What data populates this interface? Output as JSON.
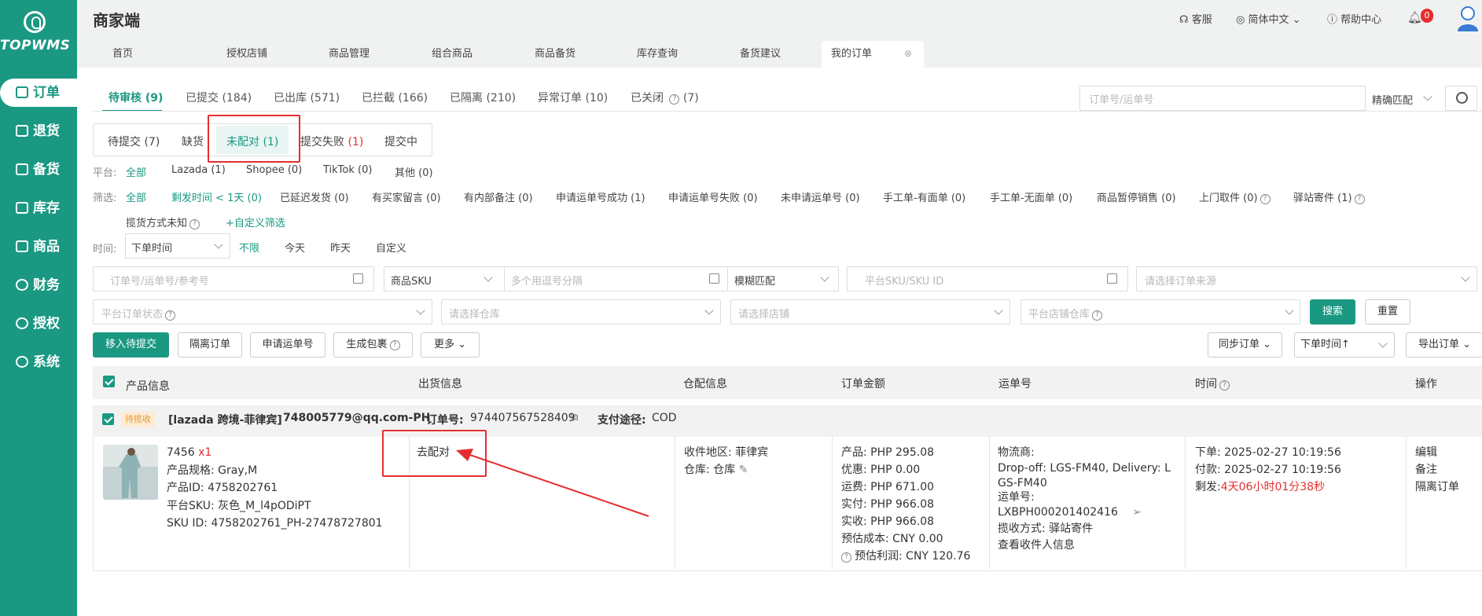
{
  "app": {
    "title": "商家端",
    "logo": "TOPWMS"
  },
  "header": {
    "service": "客服",
    "language": "简体中文",
    "help_center": "帮助中心",
    "notification_count": "0"
  },
  "sidebar": {
    "items": [
      {
        "label": "订单",
        "icon": "order-icon"
      },
      {
        "label": "退货",
        "icon": "return-icon"
      },
      {
        "label": "备货",
        "icon": "stock-icon"
      },
      {
        "label": "库存",
        "icon": "inventory-icon"
      },
      {
        "label": "商品",
        "icon": "goods-icon"
      },
      {
        "label": "财务",
        "icon": "finance-icon"
      },
      {
        "label": "授权",
        "icon": "auth-icon"
      },
      {
        "label": "系统",
        "icon": "system-icon"
      }
    ]
  },
  "page_tabs": [
    "首页",
    "授权店铺",
    "商品管理",
    "组合商品",
    "商品备货",
    "库存查询",
    "备货建议",
    "我的订单"
  ],
  "status_tabs": [
    "待审核 (9)",
    "已提交 (184)",
    "已出库 (571)",
    "已拦截 (166)",
    "已隔离 (210)",
    "异常订单 (10)",
    "已关闭",
    "(7)"
  ],
  "search": {
    "placeholder": "订单号/运单号",
    "match": "精确匹配"
  },
  "sub_tabs": {
    "pending": "待提交 (7)",
    "shortage": "缺货",
    "unmatched": "未配对 (1)",
    "failed_label": "提交失败",
    "failed_count": "(1)",
    "submitting": "提交中"
  },
  "platform_filter": {
    "label": "平台:",
    "options": [
      "全部",
      "Lazada (1)",
      "Shopee (0)",
      "TikTok (0)",
      "其他 (0)"
    ]
  },
  "screen_filter": {
    "label": "筛选:",
    "options": [
      "全部",
      "剩发时间 < 1天 (0)",
      "已延迟发货 (0)",
      "有买家留言 (0)",
      "有内部备注 (0)",
      "申请运单号成功 (1)",
      "申请运单号失败 (0)",
      "未申请运单号 (0)",
      "手工单-有面单 (0)",
      "手工单-无面单 (0)",
      "商品暂停销售 (0)",
      "上门取件 (0)",
      "驿站寄件 (1)"
    ],
    "row2": [
      "揽货方式未知",
      "+自定义筛选"
    ]
  },
  "time_filter": {
    "label": "时间:",
    "select": "下单时间",
    "options": [
      "不限",
      "今天",
      "昨天",
      "自定义"
    ]
  },
  "search_fields": {
    "order_no": "订单号/运单号/参考号",
    "sku_type": "商品SKU",
    "multi": "多个用逗号分隔",
    "fuzzy": "模糊匹配",
    "platform_sku": "平台SKU/SKU ID",
    "source": "请选择订单来源",
    "platform_status": "平台订单状态",
    "warehouse": "请选择仓库",
    "store": "请选择店铺",
    "store_warehouse": "平台店铺仓库",
    "search_btn": "搜索",
    "reset_btn": "重置"
  },
  "actions": {
    "move": "移入待提交",
    "isolate": "隔离订单",
    "apply": "申请运单号",
    "package": "生成包裹",
    "more": "更多",
    "sync": "同步订单",
    "sort": "下单时间↑",
    "export": "导出订单"
  },
  "table": {
    "headers": [
      "产品信息",
      "出货信息",
      "仓配信息",
      "订单金额",
      "运单号",
      "时间",
      "操作"
    ],
    "order": {
      "badge": "待揽收",
      "store": "[lazada 跨境-菲律宾]",
      "email": "748005779@qq.com-PH",
      "order_label": "订单号:",
      "order_no": "974407567528409",
      "pay_label": "支付途径:",
      "pay": "COD",
      "product": {
        "name": "7456",
        "qty": "x1",
        "spec": "产品规格: Gray,M",
        "pid": "产品ID: 4758202761",
        "psku": "平台SKU: 灰色_M_l4pODiPT",
        "skuid": "SKU ID: 4758202761_PH-27478727801"
      },
      "ship_action": "去配对",
      "region": "收件地区: 菲律宾",
      "warehouse": "仓库: 仓库",
      "amounts": [
        "产品: PHP 295.08",
        "优惠: PHP 0.00",
        "运费: PHP 671.00",
        "实付: PHP 966.08",
        "实收: PHP 966.08",
        "预估成本: CNY 0.00",
        "预估利润: CNY 120.76"
      ],
      "carrier_label": "物流商:",
      "carrier": "Drop-off: LGS-FM40, Delivery: LGS-FM40",
      "tracking_label": "运单号:",
      "tracking": "LXBPH000201402416",
      "pickup": "揽收方式: 驿站寄件",
      "view_receiver": "查看收件人信息",
      "order_time": "下单: 2025-02-27 10:19:56",
      "pay_time": "付款: 2025-02-27 10:19:56",
      "remain_label": "剩发:",
      "remain": "4天06小时01分38秒",
      "ops": [
        "编辑",
        "备注",
        "隔离订单"
      ]
    }
  },
  "colors": {
    "accent": "#1a9882",
    "danger": "#e62e2e",
    "badge_bg": "#fdebd3",
    "badge_text": "#e99a2c"
  }
}
